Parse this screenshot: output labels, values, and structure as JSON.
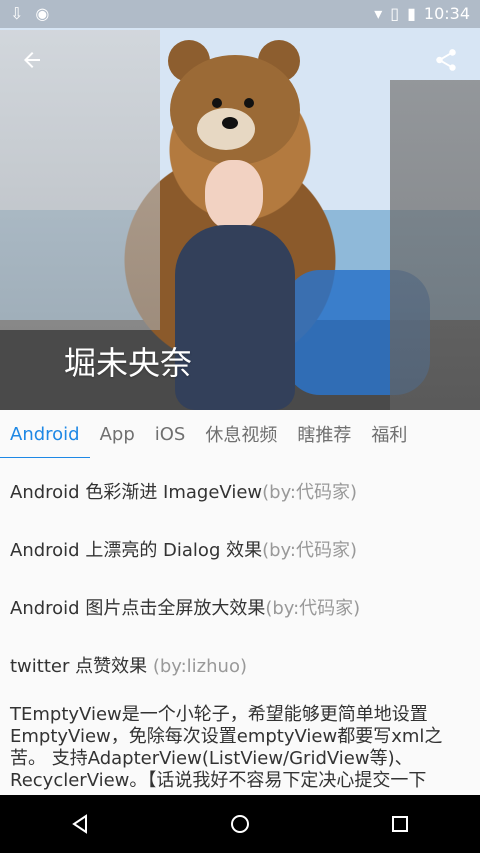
{
  "status": {
    "time": "10:34",
    "icons": [
      "download-icon",
      "android-icon",
      "wifi-icon",
      "no-sim-icon",
      "battery-charging-icon"
    ]
  },
  "hero": {
    "title": "堀未央奈"
  },
  "tabs": [
    {
      "label": "Android",
      "active": true
    },
    {
      "label": "App"
    },
    {
      "label": "iOS"
    },
    {
      "label": "休息视频"
    },
    {
      "label": "瞎推荐"
    },
    {
      "label": "福利"
    }
  ],
  "list": [
    {
      "title": "Android 色彩渐进 ImageView",
      "by": "(by:代码家)"
    },
    {
      "title": "Android 上漂亮的 Dialog 效果",
      "by": "(by:代码家)"
    },
    {
      "title": "Android 图片点击全屏放大效果",
      "by": "(by:代码家)"
    },
    {
      "title": "twitter 点赞效果 ",
      "by": "(by:lizhuo)"
    },
    {
      "text": "TEmptyView是一个小轮子，希望能够更简单地设置EmptyView，免除每次设置emptyView都要写xml之苦。 支持AdapterView(ListView/GridView等)、RecyclerView。【话说我好不容易下定决心提交一下"
    }
  ],
  "nav": [
    "back-icon",
    "home-icon",
    "recents-icon"
  ]
}
